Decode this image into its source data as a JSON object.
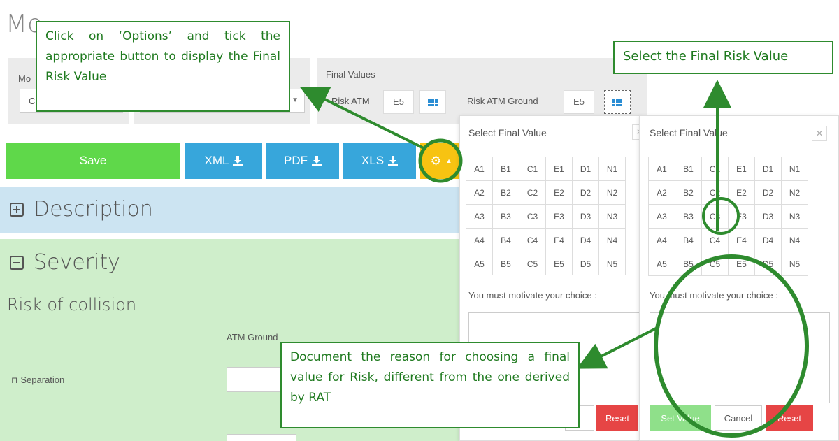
{
  "page": {
    "title_fragment": "Mo"
  },
  "filters": {
    "first_label": "Mo",
    "first_value": "C",
    "final_values_label": "Final Values",
    "risk_atm_label": "Risk ATM",
    "risk_atm_value": "E5",
    "risk_atm_ground_label": "Risk ATM Ground",
    "risk_atm_ground_value": "E5"
  },
  "toolbar": {
    "save_label": "Save",
    "xml_label": "XML",
    "pdf_label": "PDF",
    "xls_label": "XLS",
    "colors": {
      "save": "#5fd84a",
      "export": "#37a6db",
      "options": "#f7c312"
    }
  },
  "sections": {
    "description": "Description",
    "severity": "Severity",
    "risk_heading": "Risk of collision",
    "atm_ground_col": "ATM Ground",
    "separation_label": "Separation"
  },
  "popover": {
    "title": "Select Final Value",
    "close_icon": "close-icon",
    "grid": [
      [
        "A1",
        "B1",
        "C1",
        "E1",
        "D1",
        "N1"
      ],
      [
        "A2",
        "B2",
        "C2",
        "E2",
        "D2",
        "N2"
      ],
      [
        "A3",
        "B3",
        "C3",
        "E3",
        "D3",
        "N3"
      ],
      [
        "A4",
        "B4",
        "C4",
        "E4",
        "D4",
        "N4"
      ],
      [
        "A5",
        "B5",
        "C5",
        "E5",
        "D5",
        "N5"
      ]
    ],
    "motivate": "You must motivate your choice :",
    "set_value": "Set Value",
    "cancel": "Cancel",
    "reset": "Reset",
    "selected": "C3"
  },
  "callouts": {
    "options": "Click on ‘Options’ and tick the appropriate button to display the Final Risk Value",
    "select": "Select the Final Risk Value",
    "document": "Document the reason for choosing a final value for Risk, different from the one derived by RAT",
    "annotation_color": "#2e8b2e"
  }
}
